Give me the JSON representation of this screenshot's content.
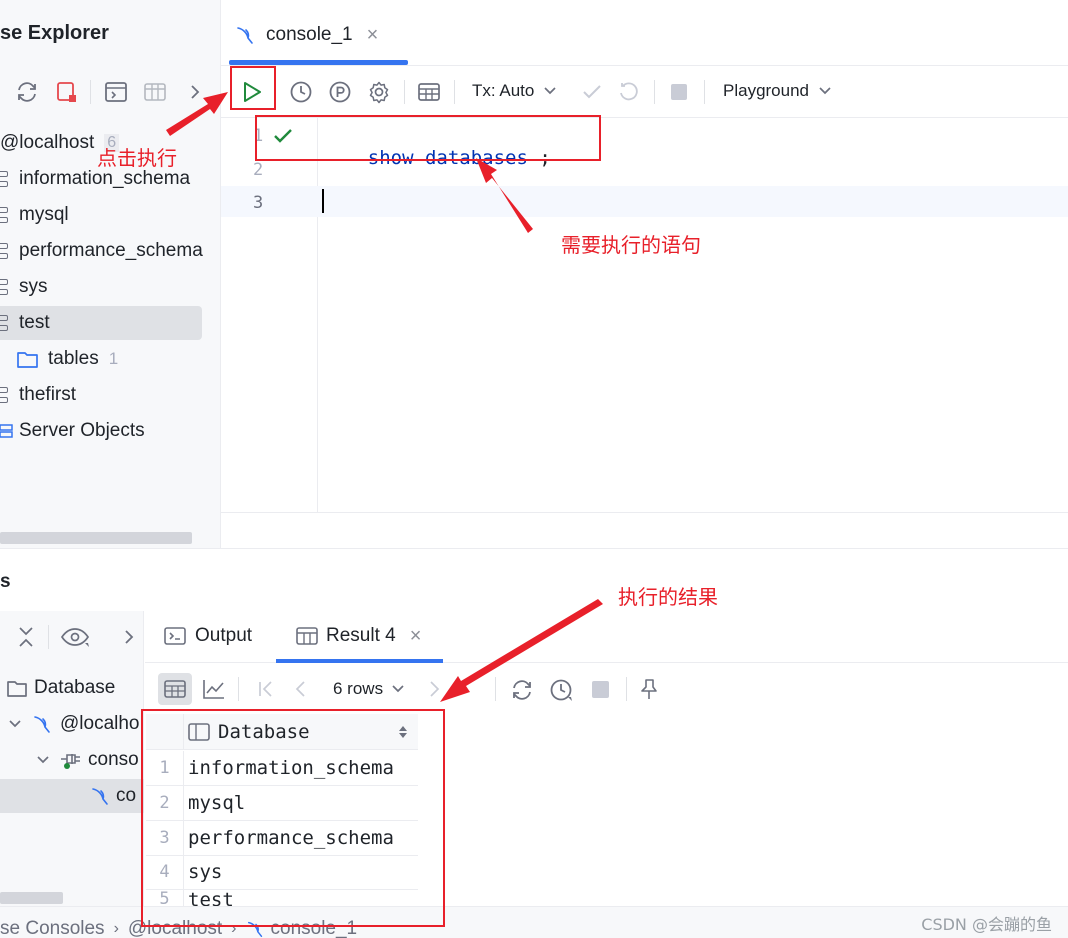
{
  "explorer": {
    "title": "se Explorer",
    "host_label": "@localhost",
    "host_count": "6",
    "items": [
      {
        "label": "information_schema"
      },
      {
        "label": "mysql"
      },
      {
        "label": "performance_schema"
      },
      {
        "label": "sys"
      },
      {
        "label": "test"
      },
      {
        "label": "thefirst"
      }
    ],
    "tables_label": "tables",
    "tables_count": "1",
    "server_objects_label": "Server Objects"
  },
  "editor": {
    "tab_label": "console_1",
    "tx_label": "Tx: Auto",
    "playground_label": "Playground",
    "line_numbers": [
      "1",
      "2",
      "3"
    ],
    "code": {
      "kw1": "show",
      "kw2": "databases",
      "semi": ";"
    }
  },
  "services": {
    "title": "s",
    "tree": {
      "database_label": "Database",
      "host_label": "@localho",
      "console_label": "conso",
      "session_label": "co"
    },
    "tabs": {
      "output": "Output",
      "result": "Result 4"
    },
    "rows_label": "6 rows",
    "grid": {
      "column": "Database",
      "rows": [
        {
          "n": "1",
          "v": "information_schema"
        },
        {
          "n": "2",
          "v": "mysql"
        },
        {
          "n": "3",
          "v": "performance_schema"
        },
        {
          "n": "4",
          "v": "sys"
        },
        {
          "n": "5",
          "v": "test"
        }
      ]
    }
  },
  "statusbar": {
    "crumb1": "se Consoles",
    "crumb2": "@localhost",
    "crumb3": "console_1",
    "watermark": "CSDN @会蹦的鱼"
  },
  "annotations": {
    "click_run": "点击执行",
    "statement": "需要执行的语句",
    "result": "执行的结果"
  },
  "colors": {
    "accent": "#3574f0",
    "annotation": "#e8202a",
    "keyword": "#0033b3",
    "success": "#208a3c"
  }
}
